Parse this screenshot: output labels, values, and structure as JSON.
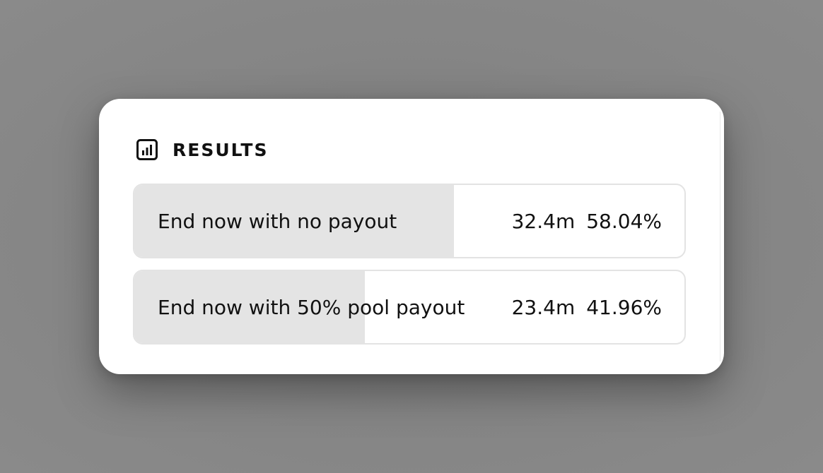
{
  "results": {
    "title": "RESULTS",
    "icon": "bar-chart-icon",
    "options": [
      {
        "label": "End now with no payout",
        "votes": "32.4m",
        "percent_label": "58.04%",
        "share": 0.5804
      },
      {
        "label": "End now with 50% pool payout",
        "votes": "23.4m",
        "percent_label": "41.96%",
        "share": 0.4196
      }
    ]
  },
  "colors": {
    "background": "#858585",
    "card": "#ffffff",
    "fill": "#e4e4e4",
    "border": "#e3e3e3",
    "text": "#111111"
  }
}
